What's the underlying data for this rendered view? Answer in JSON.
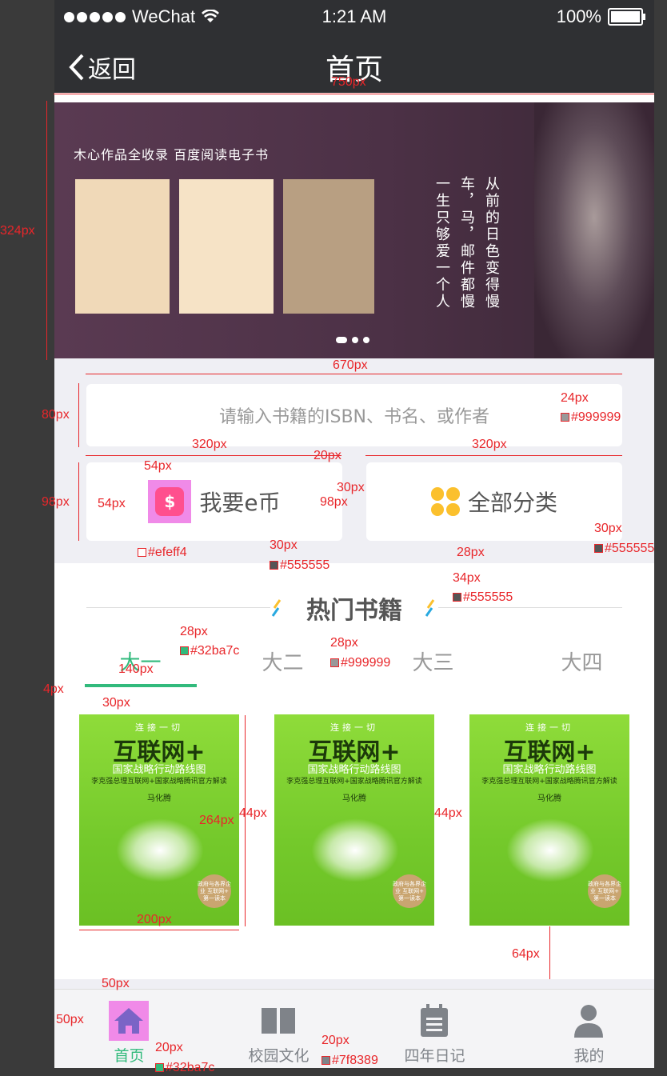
{
  "status": {
    "carrier": "WeChat",
    "time": "1:21 AM",
    "battery": "100%"
  },
  "nav": {
    "back": "返回",
    "title": "首页"
  },
  "banner": {
    "caption": "木心作品全收录  百度阅读电子书",
    "poem_right": "从前的日色变得慢",
    "poem_mid": "车，马，邮件都慢",
    "poem_left": "一生只够爱一个人",
    "pager_pages": 3,
    "pager_active": 1
  },
  "search": {
    "placeholder": "请输入书籍的ISBN、书名、或作者"
  },
  "cards": {
    "coin": "我要e币",
    "coin_icon": "$",
    "category": "全部分类"
  },
  "hot": {
    "title": "热门书籍"
  },
  "tabs": [
    {
      "label": "大一",
      "active": true
    },
    {
      "label": "大二"
    },
    {
      "label": "大三"
    },
    {
      "label": "大四"
    }
  ],
  "book": {
    "tagline": "连接一切",
    "title": "互联网+",
    "subtitle": "国家战略行动路线图",
    "line": "李克强总理互联网+国家战略腾讯官方解读",
    "author": "马化腾",
    "seal": "政府与各界企业 互联网+ 第一读本"
  },
  "tabbar": [
    {
      "label": "首页",
      "icon": "home-icon",
      "active": true
    },
    {
      "label": "校园文化",
      "icon": "book-icon"
    },
    {
      "label": "四年日记",
      "icon": "calendar-icon"
    },
    {
      "label": "我的",
      "icon": "user-icon"
    }
  ],
  "colors": {
    "accent": "#32ba7c",
    "text_dark": "#555555",
    "text_gray": "#999999",
    "tab_gray": "#7f8389",
    "bg": "#efeff4"
  },
  "annotations": {
    "w750": "750px",
    "h324": "324px",
    "w670": "670px",
    "h80": "80px",
    "fs24": "24px",
    "c999": "#999999",
    "w320a": "320px",
    "gap20": "20px",
    "w320b": "320px",
    "h98": "98px",
    "w54": "54px",
    "h54": "54px",
    "fs30a": "30px",
    "h98b": "98px",
    "fs30b": "30px",
    "fs30c": "30px",
    "c555a": "#555555",
    "cefeff4": "#efeff4",
    "fs30d": "30px",
    "c555b": "#555555",
    "h28": "28px",
    "fs34": "34px",
    "c555c": "#555555",
    "fs28a": "28px",
    "c32ba7c": "#32ba7c",
    "fs28b": "28px",
    "c999b": "#999999",
    "w140": "140px",
    "h4": "4px",
    "gap30": "30px",
    "h264": "264px",
    "gap44a": "44px",
    "gap44b": "44px",
    "w200": "200px",
    "h64": "64px",
    "w50": "50px",
    "h50": "50px",
    "fs20a": "20px",
    "c32b": "#32ba7c",
    "fs20b": "20px",
    "c7f8389": "#7f8389"
  }
}
